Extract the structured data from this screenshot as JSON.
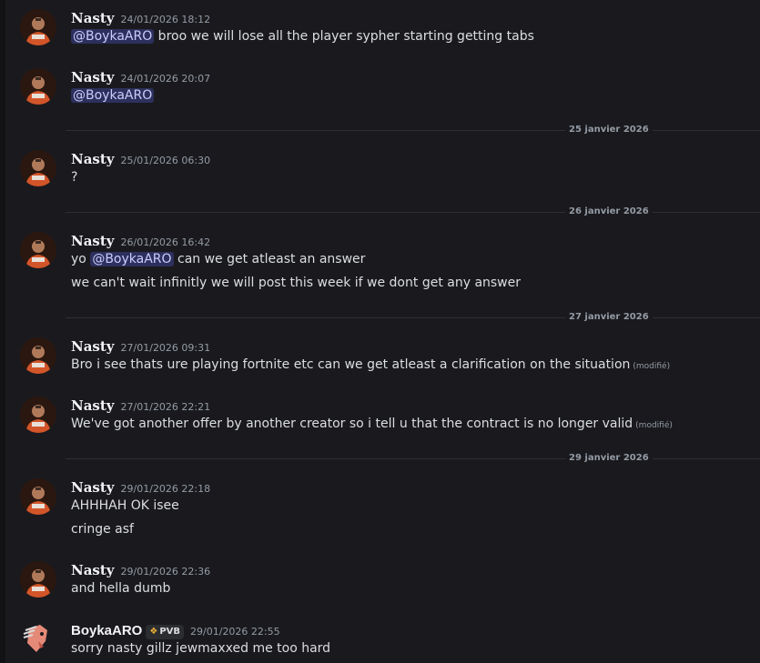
{
  "messages": [
    {
      "author": "Nasty",
      "timestamp": "24/01/2026 18:12",
      "lines": [
        {
          "mention": "@BoykaARO",
          "after": " broo we will lose all the player sypher starting getting tabs"
        }
      ]
    },
    {
      "author": "Nasty",
      "timestamp": "24/01/2026 20:07",
      "lines": [
        {
          "mention": "@BoykaARO"
        }
      ]
    },
    {
      "author": "Nasty",
      "timestamp": "25/01/2026 06:30",
      "lines": [
        {
          "text": "?"
        }
      ]
    },
    {
      "author": "Nasty",
      "timestamp": "26/01/2026 16:42",
      "lines": [
        {
          "before": "yo ",
          "mention": "@BoykaARO",
          "after": " can we get atleast an answer"
        },
        {
          "text": "we can't wait infinitly we will post this week if we dont get any answer"
        }
      ]
    },
    {
      "author": "Nasty",
      "timestamp": "27/01/2026 09:31",
      "lines": [
        {
          "text": "Bro i see thats ure playing fortnite etc can we get atleast a clarification on the situation",
          "edited": "(modifié)"
        }
      ]
    },
    {
      "author": "Nasty",
      "timestamp": "27/01/2026 22:21",
      "lines": [
        {
          "text": "We've got another offer by another creator so i tell u that the contract is no longer valid",
          "edited": "(modifié)"
        }
      ]
    },
    {
      "author": "Nasty",
      "timestamp": "29/01/2026 22:18",
      "lines": [
        {
          "text": "AHHHAH OK isee"
        },
        {
          "text": "cringe asf"
        }
      ]
    },
    {
      "author": "Nasty",
      "timestamp": "29/01/2026 22:36",
      "lines": [
        {
          "text": "and hella dumb"
        }
      ]
    },
    {
      "author": "BoykaARO",
      "badge": "PVB",
      "timestamp": "29/01/2026 22:55",
      "lines": [
        {
          "text": "sorry nasty gillz jewmaxxed me too hard"
        }
      ]
    }
  ],
  "dividers": [
    "25 janvier 2026",
    "26 janvier 2026",
    "27 janvier 2026",
    "29 janvier 2026"
  ],
  "colors": {
    "background": "#1a1a1e",
    "mention_bg": "rgba(88,101,242,0.3)",
    "mention_text": "#c9cdfb",
    "timestamp": "#949ba4",
    "badge_icon": "#f0b232"
  }
}
